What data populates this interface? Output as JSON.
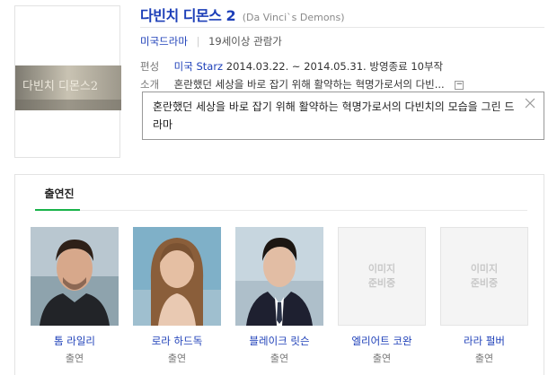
{
  "show": {
    "title": "다빈치 디몬스",
    "season": "2",
    "original_title": "(Da Vinci`s Demons)",
    "genre": "미국드라마",
    "age_rating": "19세이상 관람가",
    "poster_text": "다빈치 디몬스2"
  },
  "info": {
    "schedule_label": "편성",
    "network": "미국 Starz",
    "schedule": "2014.03.22. ~ 2014.05.31.",
    "status": "방영종료",
    "episodes": "10부작",
    "intro_label": "소개",
    "intro_short": "혼란했던 세상을 바로 잡기 위해 활약하는 혁명가로서의 다빈...",
    "collapse_symbol": "−"
  },
  "tooltip": {
    "text": "혼란했던 세상을 바로 잡기 위해 활약하는 혁명가로서의 다빈치의 모습을 그린 드라마"
  },
  "cast": {
    "tab_label": "출연진",
    "placeholder_text": "이미지 준비중",
    "members": [
      {
        "name": "톰 라일리",
        "role": "출연"
      },
      {
        "name": "로라 하드독",
        "role": "출연"
      },
      {
        "name": "블레이크 릿슨",
        "role": "출연"
      },
      {
        "name": "엘리어트 코완",
        "role": "출연"
      },
      {
        "name": "라라 펄버",
        "role": "출연"
      }
    ]
  },
  "colors": {
    "link": "#1d3fb8",
    "tab_accent": "#19b34a"
  },
  "icons": {
    "tooltip_close": "close-icon",
    "collapse": "collapse-icon"
  }
}
